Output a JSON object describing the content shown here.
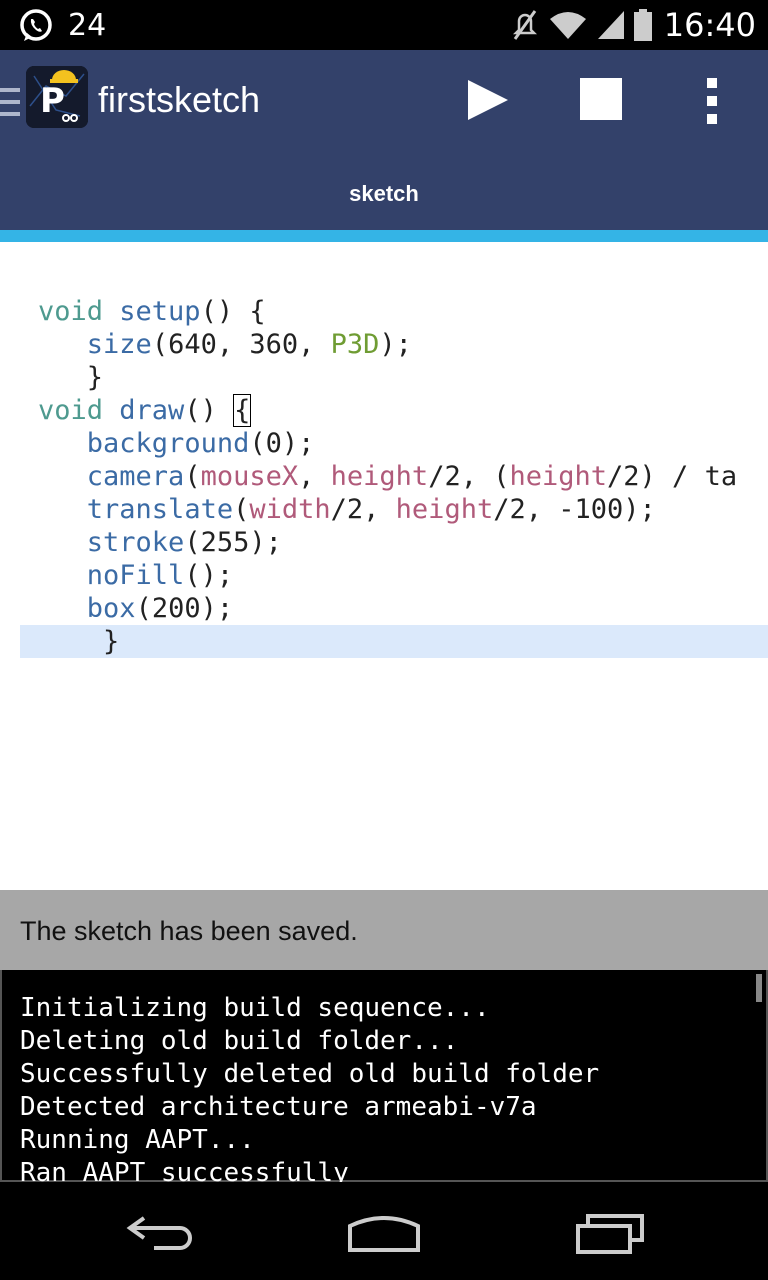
{
  "status_bar": {
    "notification_count": "24",
    "time": "16:40"
  },
  "action_bar": {
    "title": "firstsketch",
    "tab_label": "sketch"
  },
  "editor": {
    "lines": [
      [
        {
          "t": "void ",
          "c": "kw"
        },
        {
          "t": "setup",
          "c": "fn"
        },
        {
          "t": "() {",
          "c": ""
        }
      ],
      [
        {
          "t": "   ",
          "c": ""
        },
        {
          "t": "size",
          "c": "fn"
        },
        {
          "t": "(640, 360, ",
          "c": ""
        },
        {
          "t": "P3D",
          "c": "cn"
        },
        {
          "t": ");",
          "c": ""
        }
      ],
      [
        {
          "t": "   }",
          "c": ""
        }
      ],
      [
        {
          "t": "void ",
          "c": "kw"
        },
        {
          "t": "draw",
          "c": "fn"
        },
        {
          "t": "() ",
          "c": ""
        },
        {
          "t": "{",
          "c": "cursor"
        }
      ],
      [
        {
          "t": "   ",
          "c": ""
        },
        {
          "t": "background",
          "c": "fn"
        },
        {
          "t": "(0);",
          "c": ""
        }
      ],
      [
        {
          "t": "   ",
          "c": ""
        },
        {
          "t": "camera",
          "c": "fn"
        },
        {
          "t": "(",
          "c": ""
        },
        {
          "t": "mouseX",
          "c": "vr"
        },
        {
          "t": ", ",
          "c": ""
        },
        {
          "t": "height",
          "c": "vr"
        },
        {
          "t": "/2, (",
          "c": ""
        },
        {
          "t": "height",
          "c": "vr"
        },
        {
          "t": "/2) / ta",
          "c": ""
        }
      ],
      [
        {
          "t": "   ",
          "c": ""
        },
        {
          "t": "translate",
          "c": "fn"
        },
        {
          "t": "(",
          "c": ""
        },
        {
          "t": "width",
          "c": "vr"
        },
        {
          "t": "/2, ",
          "c": ""
        },
        {
          "t": "height",
          "c": "vr"
        },
        {
          "t": "/2, -100);",
          "c": ""
        }
      ],
      [
        {
          "t": "   ",
          "c": ""
        },
        {
          "t": "stroke",
          "c": "fn"
        },
        {
          "t": "(255);",
          "c": ""
        }
      ],
      [
        {
          "t": "   ",
          "c": ""
        },
        {
          "t": "noFill",
          "c": "fn"
        },
        {
          "t": "();",
          "c": ""
        }
      ],
      [
        {
          "t": "   ",
          "c": ""
        },
        {
          "t": "box",
          "c": "fn"
        },
        {
          "t": "(200);",
          "c": ""
        }
      ],
      [
        {
          "t": "    }",
          "c": ""
        }
      ]
    ]
  },
  "message": "The sketch has been saved.",
  "console": {
    "lines": [
      "Initializing build sequence...",
      "Deleting old build folder...",
      "Successfully deleted old build folder",
      "Detected architecture armeabi-v7a",
      "Running AAPT...",
      "Ran AAPT successfully"
    ]
  },
  "colors": {
    "action_bar": "#33416a",
    "tab_indicator": "#34b4e6",
    "message_bar": "#a7a7a7",
    "keyword": "#4e9a8f",
    "function": "#3b6ba5",
    "constant": "#6f9c33",
    "variable": "#b05a7a",
    "current_line": "#dbe9fb"
  },
  "icons": [
    "whatsapp-icon",
    "mute-icon",
    "wifi-icon",
    "signal-icon",
    "battery-icon",
    "drawer-icon",
    "processing-app-icon",
    "play-icon",
    "stop-icon",
    "overflow-menu-icon",
    "back-icon",
    "home-icon",
    "recent-apps-icon"
  ]
}
